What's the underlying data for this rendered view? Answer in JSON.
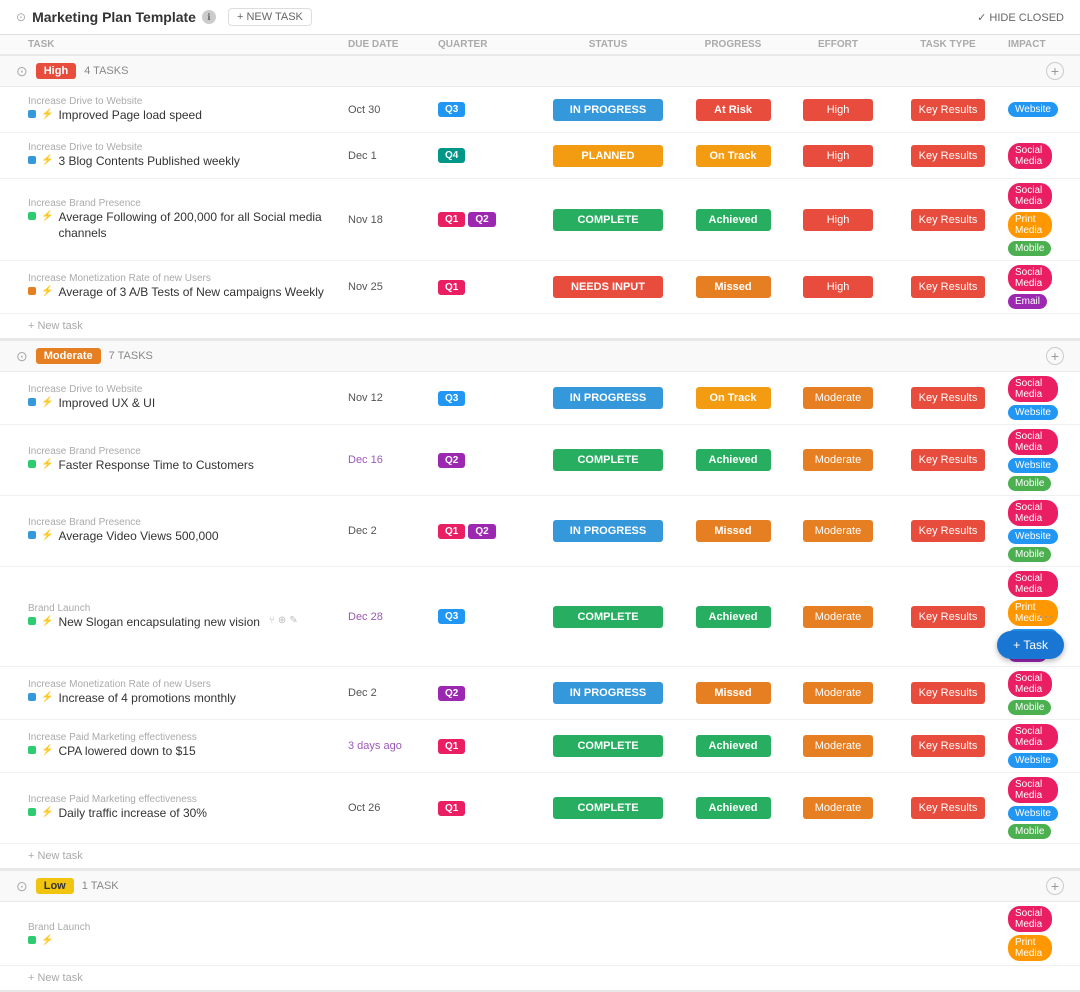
{
  "header": {
    "title": "Marketing Plan Template",
    "new_task_label": "+ NEW TASK",
    "hide_closed_label": "✓ HIDE CLOSED",
    "info_icon": "ℹ"
  },
  "columns": {
    "task_label": "TASK",
    "due_date_label": "DUE DATE",
    "quarter_label": "QUARTER",
    "status_label": "STATUS",
    "progress_label": "PROGRESS",
    "effort_label": "EFFORT",
    "task_type_label": "TASK TYPE",
    "impact_label": "IMPACT"
  },
  "groups": [
    {
      "id": "high",
      "priority": "High",
      "priority_class": "priority-high",
      "task_count": "4 TASKS",
      "tasks": [
        {
          "parent": "Increase Drive to Website",
          "name": "Improved Page load speed",
          "dot_class": "task-dot-blue",
          "due_date": "Oct 30",
          "due_date_class": "",
          "quarters": [
            {
              "label": "Q3",
              "class": "q3"
            }
          ],
          "status": "IN PROGRESS",
          "status_class": "status-inprogress",
          "progress": "At Risk",
          "progress_class": "progress-atrisk",
          "effort": "High",
          "effort_class": "effort-high",
          "task_type": "Key Results",
          "impact": [
            {
              "label": "Website",
              "class": "impact-website"
            }
          ]
        },
        {
          "parent": "Increase Drive to Website",
          "name": "3 Blog Contents Published weekly",
          "dot_class": "task-dot-blue",
          "due_date": "Dec 1",
          "due_date_class": "",
          "quarters": [
            {
              "label": "Q4",
              "class": "q4"
            }
          ],
          "status": "PLANNED",
          "status_class": "status-planned",
          "progress": "On Track",
          "progress_class": "progress-ontrack",
          "effort": "High",
          "effort_class": "effort-high",
          "task_type": "Key Results",
          "impact": [
            {
              "label": "Social Media",
              "class": "impact-socialmedia"
            }
          ]
        },
        {
          "parent": "Increase Brand Presence",
          "name": "Average Following of 200,000 for all Social media channels",
          "dot_class": "task-dot-green",
          "due_date": "Nov 18",
          "due_date_class": "",
          "quarters": [
            {
              "label": "Q1",
              "class": "q1"
            },
            {
              "label": "Q2",
              "class": "q2"
            }
          ],
          "status": "COMPLETE",
          "status_class": "status-complete",
          "progress": "Achieved",
          "progress_class": "progress-achieved",
          "effort": "High",
          "effort_class": "effort-high",
          "task_type": "Key Results",
          "impact": [
            {
              "label": "Social Media",
              "class": "impact-socialmedia"
            },
            {
              "label": "Print Media",
              "class": "impact-printmedia"
            },
            {
              "label": "Mobile",
              "class": "impact-mobile"
            }
          ]
        },
        {
          "parent": "Increase Monetization Rate of new Users",
          "name": "Average of 3 A/B Tests of New campaigns Weekly",
          "dot_class": "task-dot-orange",
          "due_date": "Nov 25",
          "due_date_class": "",
          "quarters": [
            {
              "label": "Q1",
              "class": "q1"
            }
          ],
          "status": "NEEDS INPUT",
          "status_class": "status-needsinput",
          "progress": "Missed",
          "progress_class": "progress-missed",
          "effort": "High",
          "effort_class": "effort-high",
          "task_type": "Key Results",
          "impact": [
            {
              "label": "Social Media",
              "class": "impact-socialmedia"
            },
            {
              "label": "Email",
              "class": "impact-email"
            }
          ]
        }
      ]
    },
    {
      "id": "moderate",
      "priority": "Moderate",
      "priority_class": "priority-moderate",
      "task_count": "7 TASKS",
      "tasks": [
        {
          "parent": "Increase Drive to Website",
          "name": "Improved UX & UI",
          "dot_class": "task-dot-blue",
          "due_date": "Nov 12",
          "due_date_class": "",
          "quarters": [
            {
              "label": "Q3",
              "class": "q3"
            }
          ],
          "status": "IN PROGRESS",
          "status_class": "status-inprogress",
          "progress": "On Track",
          "progress_class": "progress-ontrack",
          "effort": "Moderate",
          "effort_class": "effort-moderate",
          "task_type": "Key Results",
          "impact": [
            {
              "label": "Social Media",
              "class": "impact-socialmedia"
            },
            {
              "label": "Website",
              "class": "impact-website"
            }
          ]
        },
        {
          "parent": "Increase Brand Presence",
          "name": "Faster Response Time to Customers",
          "dot_class": "task-dot-green",
          "due_date": "Dec 16",
          "due_date_class": "overdue",
          "quarters": [
            {
              "label": "Q2",
              "class": "q2"
            }
          ],
          "status": "COMPLETE",
          "status_class": "status-complete",
          "progress": "Achieved",
          "progress_class": "progress-achieved",
          "effort": "Moderate",
          "effort_class": "effort-moderate",
          "task_type": "Key Results",
          "impact": [
            {
              "label": "Social Media",
              "class": "impact-socialmedia"
            },
            {
              "label": "Website",
              "class": "impact-website"
            },
            {
              "label": "Mobile",
              "class": "impact-mobile"
            }
          ]
        },
        {
          "parent": "Increase Brand Presence",
          "name": "Average Video Views 500,000",
          "dot_class": "task-dot-blue",
          "due_date": "Dec 2",
          "due_date_class": "",
          "quarters": [
            {
              "label": "Q1",
              "class": "q1"
            },
            {
              "label": "Q2",
              "class": "q2"
            }
          ],
          "status": "IN PROGRESS",
          "status_class": "status-inprogress",
          "progress": "Missed",
          "progress_class": "progress-missed",
          "effort": "Moderate",
          "effort_class": "effort-moderate",
          "task_type": "Key Results",
          "impact": [
            {
              "label": "Social Media",
              "class": "impact-socialmedia"
            },
            {
              "label": "Website",
              "class": "impact-website"
            },
            {
              "label": "Mobile",
              "class": "impact-mobile"
            }
          ]
        },
        {
          "parent": "Brand Launch",
          "name": "New Slogan encapsulating new vision",
          "dot_class": "task-dot-green",
          "due_date": "Dec 28",
          "due_date_class": "overdue",
          "quarters": [
            {
              "label": "Q3",
              "class": "q3"
            }
          ],
          "status": "COMPLETE",
          "status_class": "status-complete",
          "progress": "Achieved",
          "progress_class": "progress-achieved",
          "effort": "Moderate",
          "effort_class": "effort-moderate",
          "task_type": "Key Results",
          "impact": [
            {
              "label": "Social Media",
              "class": "impact-socialmedia"
            },
            {
              "label": "Print Media",
              "class": "impact-printmedia"
            },
            {
              "label": "Website",
              "class": "impact-website"
            },
            {
              "label": "Email",
              "class": "impact-email"
            }
          ],
          "has_actions": true
        },
        {
          "parent": "Increase Monetization Rate of new Users",
          "name": "Increase of 4 promotions monthly",
          "dot_class": "task-dot-blue",
          "due_date": "Dec 2",
          "due_date_class": "",
          "quarters": [
            {
              "label": "Q2",
              "class": "q2"
            }
          ],
          "status": "IN PROGRESS",
          "status_class": "status-inprogress",
          "progress": "Missed",
          "progress_class": "progress-missed",
          "effort": "Moderate",
          "effort_class": "effort-moderate",
          "task_type": "Key Results",
          "impact": [
            {
              "label": "Social Media",
              "class": "impact-socialmedia"
            },
            {
              "label": "Mobile",
              "class": "impact-mobile"
            }
          ]
        },
        {
          "parent": "Increase Paid Marketing effectiveness",
          "name": "CPA lowered down to $15",
          "dot_class": "task-dot-green",
          "due_date": "3 days ago",
          "due_date_class": "overdue",
          "quarters": [
            {
              "label": "Q1",
              "class": "q1"
            }
          ],
          "status": "COMPLETE",
          "status_class": "status-complete",
          "progress": "Achieved",
          "progress_class": "progress-achieved",
          "effort": "Moderate",
          "effort_class": "effort-moderate",
          "task_type": "Key Results",
          "impact": [
            {
              "label": "Social Media",
              "class": "impact-socialmedia"
            },
            {
              "label": "Website",
              "class": "impact-website"
            }
          ]
        },
        {
          "parent": "Increase Paid Marketing effectiveness",
          "name": "Daily traffic increase of 30%",
          "dot_class": "task-dot-green",
          "due_date": "Oct 26",
          "due_date_class": "",
          "quarters": [
            {
              "label": "Q1",
              "class": "q1"
            }
          ],
          "status": "COMPLETE",
          "status_class": "status-complete",
          "progress": "Achieved",
          "progress_class": "progress-achieved",
          "effort": "Moderate",
          "effort_class": "effort-moderate",
          "task_type": "Key Results",
          "impact": [
            {
              "label": "Social Media",
              "class": "impact-socialmedia"
            },
            {
              "label": "Website",
              "class": "impact-website"
            },
            {
              "label": "Mobile",
              "class": "impact-mobile"
            }
          ]
        }
      ]
    },
    {
      "id": "low",
      "priority": "Low",
      "priority_class": "priority-low",
      "task_count": "1 TASK",
      "tasks": [
        {
          "parent": "Brand Launch",
          "name": "",
          "dot_class": "task-dot-green",
          "due_date": "",
          "due_date_class": "",
          "quarters": [],
          "status": "",
          "status_class": "",
          "progress": "",
          "progress_class": "",
          "effort": "",
          "effort_class": "",
          "task_type": "",
          "impact": [
            {
              "label": "Social Media",
              "class": "impact-socialmedia"
            },
            {
              "label": "Print Media",
              "class": "impact-printmedia"
            }
          ]
        }
      ]
    }
  ],
  "new_task_label": "+ New task",
  "fab_label": "+ Task"
}
